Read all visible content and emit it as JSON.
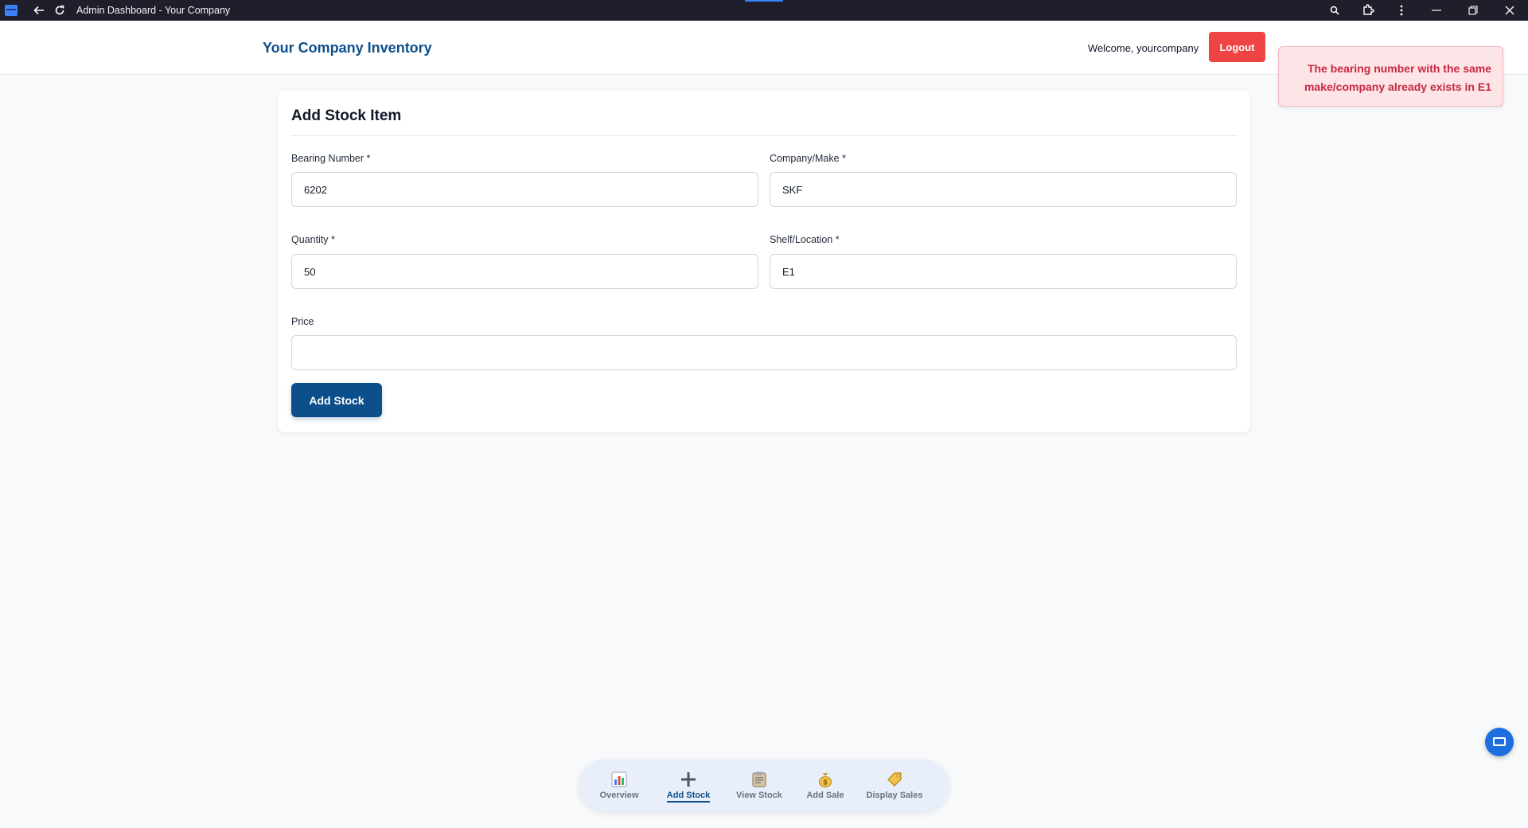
{
  "window": {
    "title": "Admin Dashboard - Your Company"
  },
  "header": {
    "brand": "Your Company Inventory",
    "welcome": "Welcome, yourcompany",
    "logout_label": "Logout"
  },
  "toast": {
    "message": "The bearing number with the same make/company already exists in E1",
    "type": "error"
  },
  "form": {
    "title": "Add Stock Item",
    "bearing_number": {
      "label": "Bearing Number *",
      "value": "6202"
    },
    "company_make": {
      "label": "Company/Make *",
      "value": "SKF"
    },
    "quantity": {
      "label": "Quantity *",
      "value": "50"
    },
    "shelf_location": {
      "label": "Shelf/Location *",
      "value": "E1"
    },
    "price": {
      "label": "Price",
      "value": ""
    },
    "submit_label": "Add Stock"
  },
  "bottom_nav": {
    "items": [
      {
        "label": "Overview",
        "icon": "bar-chart-icon",
        "active": false
      },
      {
        "label": "Add Stock",
        "icon": "plus-icon",
        "active": true
      },
      {
        "label": "View Stock",
        "icon": "clipboard-icon",
        "active": false
      },
      {
        "label": "Add Sale",
        "icon": "money-bag-icon",
        "active": false
      },
      {
        "label": "Display Sales",
        "icon": "price-tag-icon",
        "active": false
      }
    ]
  },
  "colors": {
    "brand": "#0d4f8b",
    "danger": "#ef4444",
    "toast_bg": "#fde4e7",
    "toast_text": "#c62840"
  }
}
